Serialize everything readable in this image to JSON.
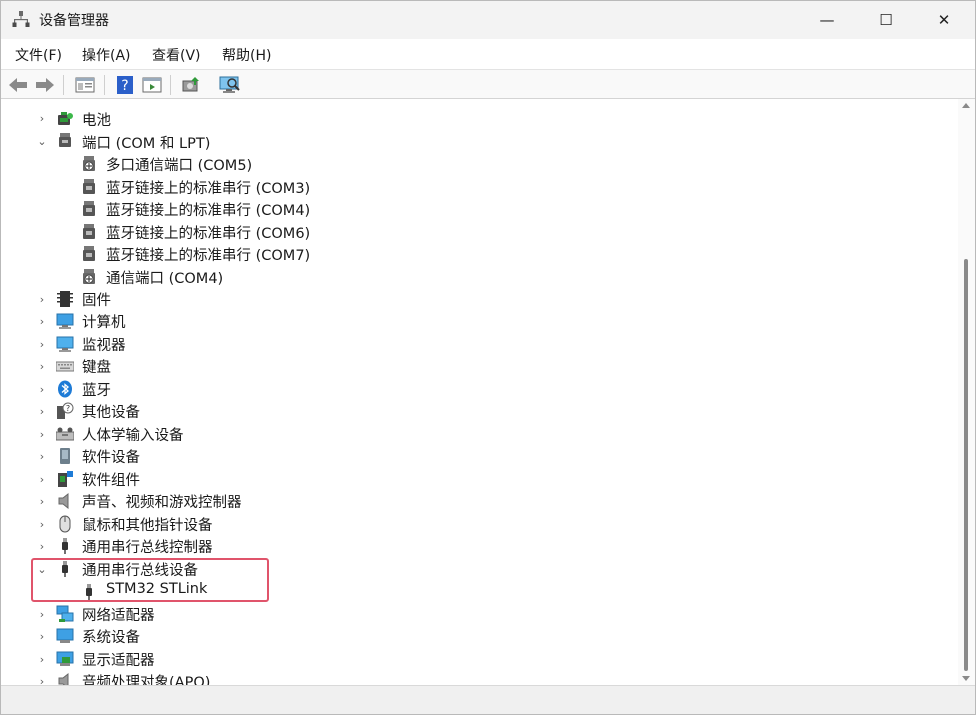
{
  "window": {
    "title": "设备管理器",
    "minimize_glyph": "—",
    "maximize_glyph": "☐",
    "close_glyph": "✕"
  },
  "menu": {
    "file": "文件(F)",
    "action": "操作(A)",
    "view": "查看(V)",
    "help": "帮助(H)"
  },
  "toolbar": {
    "icons": [
      "back-icon",
      "forward-icon",
      "properties-icon",
      "help-icon",
      "show-hide-icon",
      "update-driver-icon",
      "scan-hardware-icon"
    ]
  },
  "tree": {
    "battery": "电池",
    "ports": "端口 (COM 和 LPT)",
    "port_items": [
      "多口通信端口 (COM5)",
      "蓝牙链接上的标准串行 (COM3)",
      "蓝牙链接上的标准串行 (COM4)",
      "蓝牙链接上的标准串行 (COM6)",
      "蓝牙链接上的标准串行 (COM7)",
      "通信端口 (COM4)"
    ],
    "firmware": "固件",
    "computer": "计算机",
    "monitors": "监视器",
    "keyboards": "键盘",
    "bluetooth": "蓝牙",
    "other_devices": "其他设备",
    "hid": "人体学输入设备",
    "software_devices": "软件设备",
    "software_components": "软件组件",
    "sound": "声音、视频和游戏控制器",
    "mice": "鼠标和其他指针设备",
    "usb_controllers": "通用串行总线控制器",
    "usb_devices": "通用串行总线设备",
    "usb_device_items": [
      "STM32 STLink"
    ],
    "network_adapters": "网络适配器",
    "system_devices": "系统设备",
    "display_adapters": "显示适配器",
    "audio_processing": "音频处理对象(APO)"
  },
  "colors": {
    "highlight_border": "#e0546b",
    "bluetooth_blue": "#1e7bd6"
  }
}
